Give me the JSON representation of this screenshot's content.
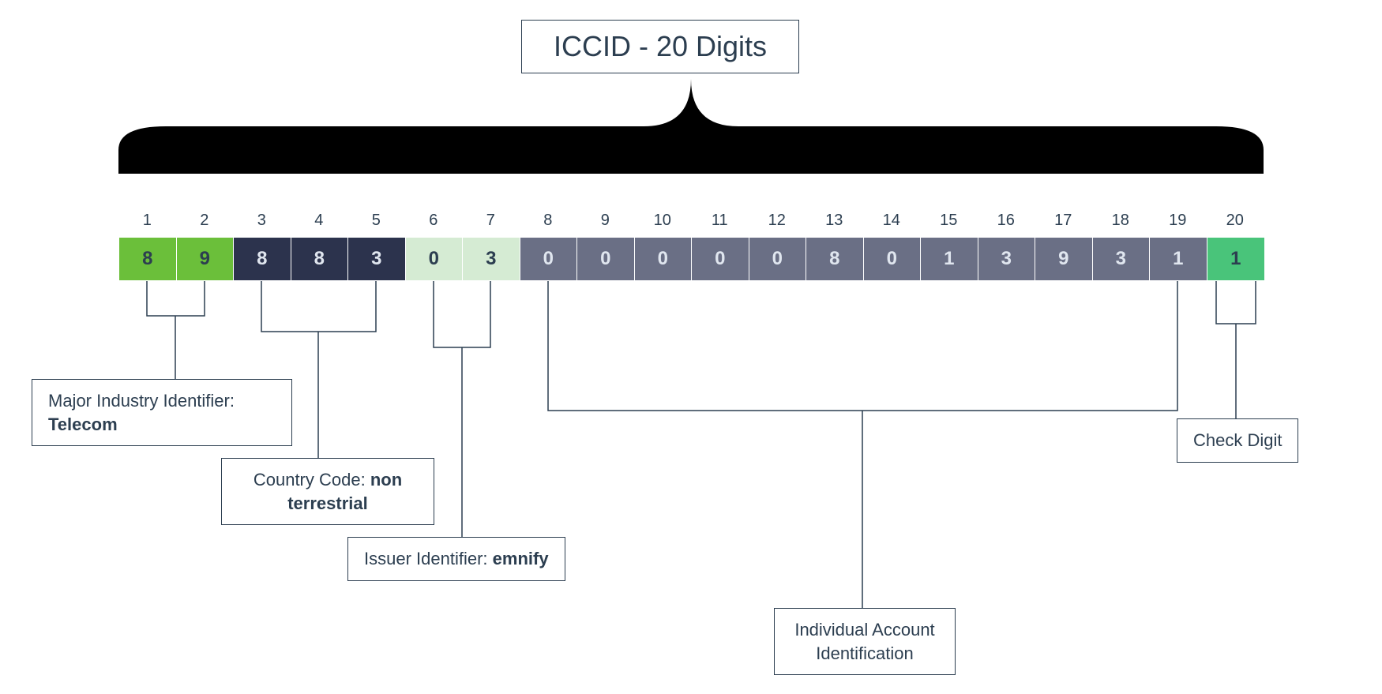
{
  "title": "ICCID - 20 Digits",
  "positions": [
    "1",
    "2",
    "3",
    "4",
    "5",
    "6",
    "7",
    "8",
    "9",
    "10",
    "11",
    "12",
    "13",
    "14",
    "15",
    "16",
    "17",
    "18",
    "19",
    "20"
  ],
  "digits": [
    "8",
    "9",
    "8",
    "8",
    "3",
    "0",
    "3",
    "0",
    "0",
    "0",
    "0",
    "0",
    "8",
    "0",
    "1",
    "3",
    "9",
    "3",
    "1",
    "1"
  ],
  "groups": {
    "mii": {
      "label": "Major Industry Identifier:",
      "value": "Telecom",
      "start": 1,
      "end": 2
    },
    "cc": {
      "label": "Country Code:",
      "value": "non terrestrial",
      "start": 3,
      "end": 5
    },
    "iin": {
      "label": "Issuer Identifier:",
      "value": "emnify",
      "start": 6,
      "end": 7
    },
    "iai": {
      "label": "Individual Account Identification",
      "value": "",
      "start": 8,
      "end": 19
    },
    "check": {
      "label": "Check Digit",
      "value": "",
      "start": 20,
      "end": 20
    }
  }
}
